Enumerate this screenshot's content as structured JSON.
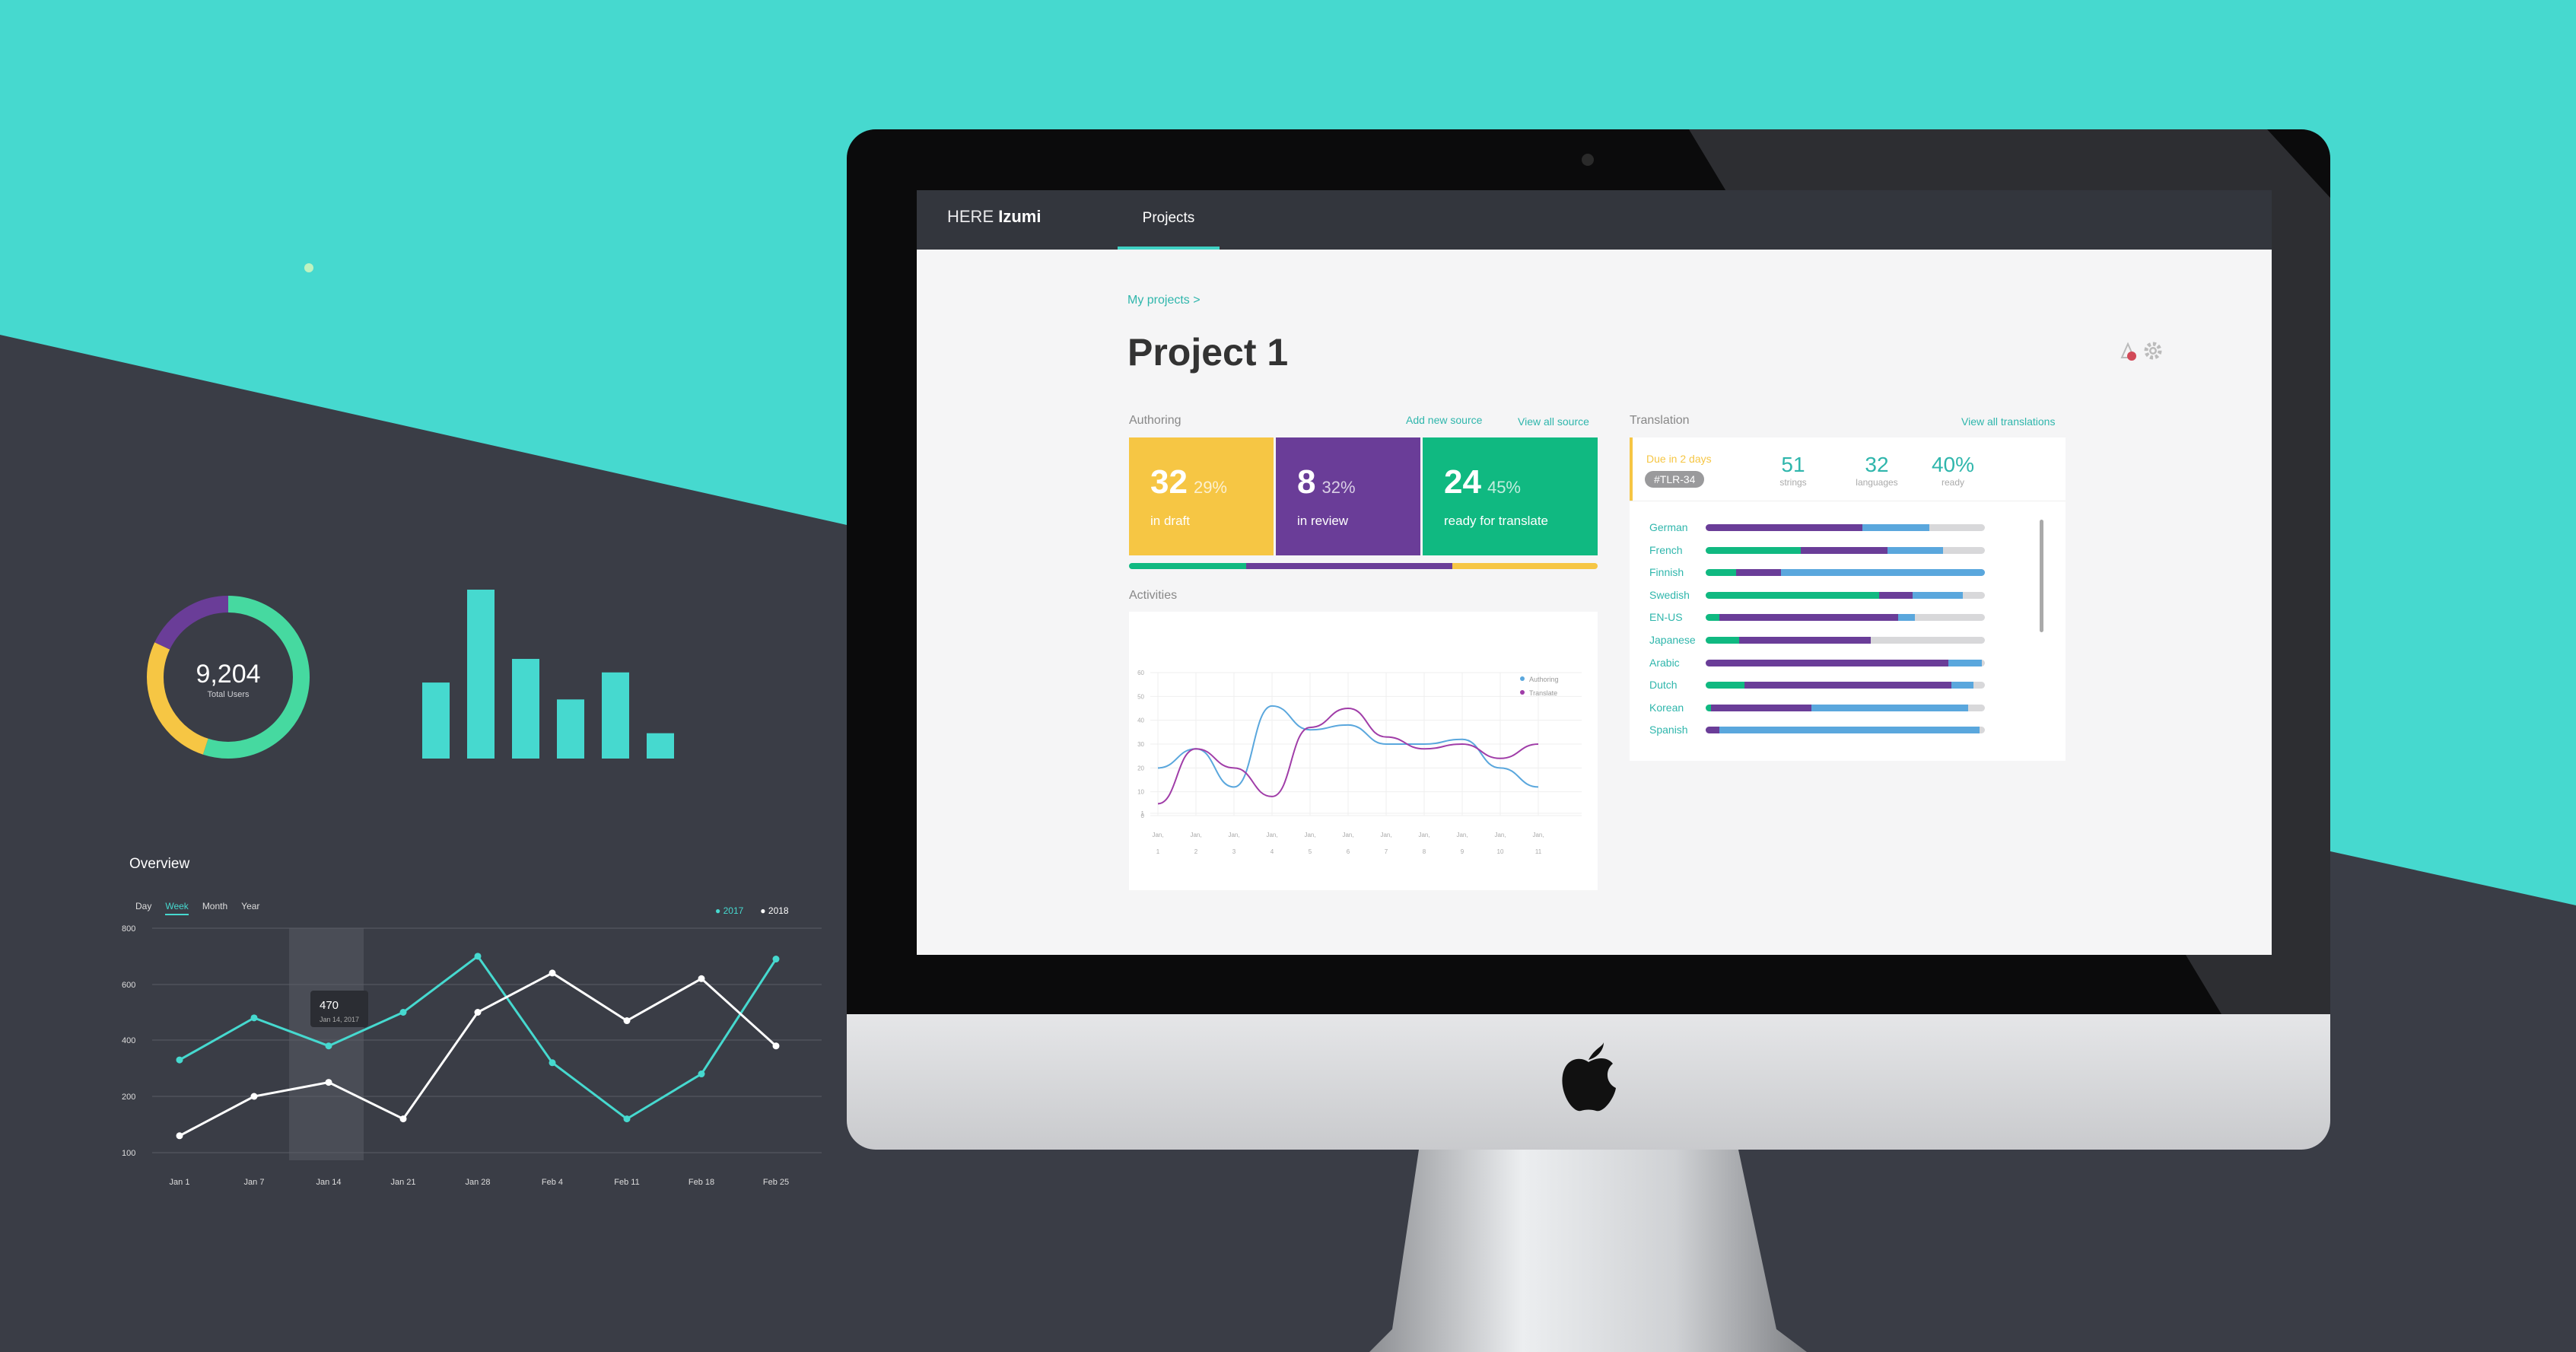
{
  "colors": {
    "teal": "#46d9cf",
    "dark": "#3a3d46",
    "yellow": "#f6c644",
    "purple": "#6a3d98",
    "green": "#10b981",
    "blue": "#5aa7dd",
    "magenta": "#a03da8"
  },
  "donut": {
    "value": "9,204",
    "label": "Total Users",
    "segments": [
      {
        "name": "teal",
        "fraction": 0.55,
        "color": "#46d9a0"
      },
      {
        "name": "yellow",
        "fraction": 0.27,
        "color": "#f6c644"
      },
      {
        "name": "purple",
        "fraction": 0.18,
        "color": "#6a3d98"
      }
    ]
  },
  "mini_bars": {
    "values": [
      45,
      100,
      59,
      35,
      51,
      15
    ]
  },
  "overview": {
    "title": "Overview",
    "tabs": [
      "Day",
      "Week",
      "Month",
      "Year"
    ],
    "active_tab": "Week",
    "legend": [
      "2017",
      "2018"
    ],
    "tooltip": {
      "value": "470",
      "date": "Jan 14, 2017"
    },
    "chart_data": {
      "type": "line",
      "categories": [
        "Jan 1",
        "Jan 7",
        "Jan 14",
        "Jan 21",
        "Jan 28",
        "Feb 4",
        "Feb 11",
        "Feb 18",
        "Feb 25"
      ],
      "series": [
        {
          "name": "2017",
          "values": [
            330,
            480,
            380,
            500,
            700,
            320,
            160,
            280,
            690
          ]
        },
        {
          "name": "2018",
          "values": [
            130,
            200,
            250,
            160,
            500,
            640,
            470,
            620,
            380
          ]
        }
      ],
      "yticks": [
        "800",
        "600",
        "400",
        "200",
        "100"
      ],
      "ylim": [
        100,
        800
      ]
    }
  },
  "app": {
    "brand_prefix": "HERE",
    "brand_name": "Izumi",
    "nav_tab": "Projects",
    "breadcrumb": "My projects >",
    "title": "Project 1",
    "authoring": {
      "label": "Authoring",
      "add_link": "Add new source",
      "view_link": "View all source",
      "cards": [
        {
          "value": "32",
          "pct": "29%",
          "label": "in draft",
          "color": "#f6c644"
        },
        {
          "value": "8",
          "pct": "32%",
          "label": "in review",
          "color": "#6a3d98"
        },
        {
          "value": "24",
          "pct": "45%",
          "label": "ready for translate",
          "color": "#10b981"
        }
      ],
      "progress": [
        {
          "fraction": 0.25,
          "color": "#10b981"
        },
        {
          "fraction": 0.44,
          "color": "#6a3d98"
        },
        {
          "fraction": 0.31,
          "color": "#f6c644"
        }
      ]
    },
    "activities": {
      "label": "Activities",
      "legend": [
        "Authoring",
        "Translate"
      ],
      "chart_data": {
        "type": "line",
        "categories": [
          "1",
          "2",
          "3",
          "4",
          "5",
          "6",
          "7",
          "8",
          "9",
          "10",
          "11"
        ],
        "series": [
          {
            "name": "Authoring",
            "values": [
              20,
              28,
              12,
              46,
              36,
              38,
              30,
              30,
              32,
              20,
              12
            ]
          },
          {
            "name": "Translate",
            "values": [
              5,
              28,
              20,
              8,
              37,
              45,
              33,
              28,
              30,
              24,
              30
            ]
          }
        ],
        "yticks": [
          "60",
          "50",
          "40",
          "30",
          "20",
          "10",
          "1",
          "0"
        ],
        "xticks_top": [
          "Jan,",
          "Jan,",
          "Jan,",
          "Jan,",
          "Jan,",
          "Jan,",
          "Jan,",
          "Jan,",
          "Jan,",
          "Jan,",
          "Jan,"
        ]
      }
    },
    "translation": {
      "label": "Translation",
      "view_link": "View all translations",
      "due": "Due in 2 days",
      "tag": "#TLR-34",
      "stats": [
        {
          "n": "51",
          "l": "strings"
        },
        {
          "n": "32",
          "l": "languages"
        },
        {
          "n": "40%",
          "l": "ready"
        }
      ],
      "languages": [
        {
          "name": "German",
          "green": 0.0,
          "purple": 0.56,
          "blue": 0.24
        },
        {
          "name": "French",
          "green": 0.34,
          "purple": 0.31,
          "blue": 0.2
        },
        {
          "name": "Finnish",
          "green": 0.11,
          "purple": 0.16,
          "blue": 0.73
        },
        {
          "name": "Swedish",
          "green": 0.62,
          "purple": 0.12,
          "blue": 0.18
        },
        {
          "name": "EN-US",
          "green": 0.05,
          "purple": 0.64,
          "blue": 0.06
        },
        {
          "name": "Japanese",
          "green": 0.12,
          "purple": 0.47,
          "blue": 0.0
        },
        {
          "name": "Arabic",
          "green": 0.0,
          "purple": 0.87,
          "blue": 0.12
        },
        {
          "name": "Dutch",
          "green": 0.14,
          "purple": 0.74,
          "blue": 0.08
        },
        {
          "name": "Korean",
          "green": 0.02,
          "purple": 0.36,
          "blue": 0.56
        },
        {
          "name": "Spanish",
          "green": 0.0,
          "purple": 0.05,
          "blue": 0.93
        }
      ]
    }
  }
}
